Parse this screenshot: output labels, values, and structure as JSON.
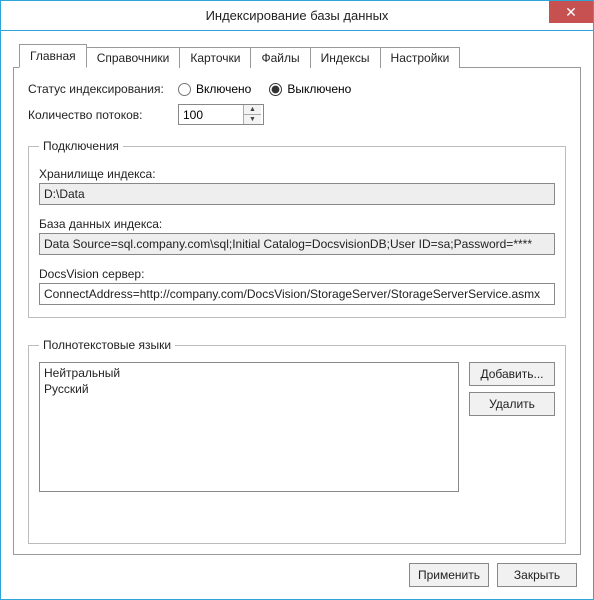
{
  "window": {
    "title": "Индексирование базы данных",
    "close_glyph": "✕"
  },
  "tabs": [
    {
      "label": "Главная",
      "active": true
    },
    {
      "label": "Справочники",
      "active": false
    },
    {
      "label": "Карточки",
      "active": false
    },
    {
      "label": "Файлы",
      "active": false
    },
    {
      "label": "Индексы",
      "active": false
    },
    {
      "label": "Настройки",
      "active": false
    }
  ],
  "status": {
    "label": "Статус индексирования:",
    "enabled_label": "Включено",
    "disabled_label": "Выключено",
    "value": "disabled"
  },
  "threads": {
    "label": "Количество потоков:",
    "value": "100"
  },
  "connections": {
    "legend": "Подключения",
    "storage_label": "Хранилище индекса:",
    "storage_value": "D:\\Data",
    "db_label": "База данных индекса:",
    "db_value": "Data Source=sql.company.com\\sql;Initial Catalog=DocsvisionDB;User ID=sa;Password=****",
    "server_label": "DocsVision сервер:",
    "server_value": "ConnectAddress=http://company.com/DocsVision/StorageServer/StorageServerService.asmx"
  },
  "languages": {
    "legend": "Полнотекстовые языки",
    "items": [
      "Нейтральный",
      "Русский"
    ],
    "add_label": "Добавить...",
    "remove_label": "Удалить"
  },
  "buttons": {
    "apply": "Применить",
    "close": "Закрыть"
  }
}
